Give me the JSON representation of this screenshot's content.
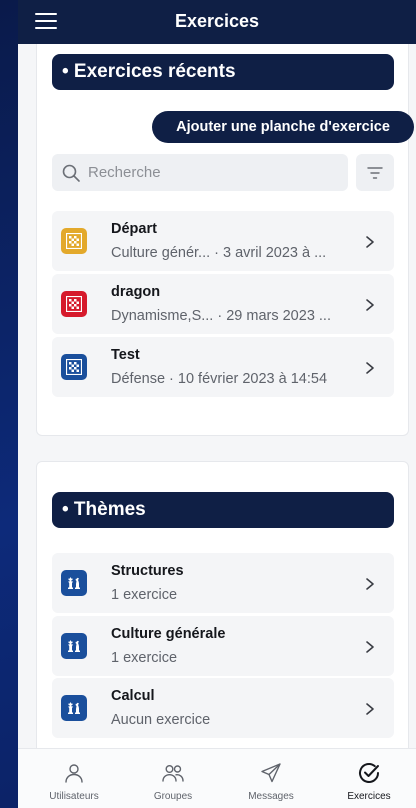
{
  "header": {
    "title": "Exercices"
  },
  "recent": {
    "title": "• Exercices récents",
    "add_button": "Ajouter une planche d'exercice",
    "search_placeholder": "Recherche",
    "items": [
      {
        "title": "Départ",
        "subtitle": "Culture génér... · 3 avril 2023 à ...",
        "color": "#e3a92b"
      },
      {
        "title": "dragon",
        "subtitle": "Dynamisme,S... · 29 mars 2023 ...",
        "color": "#d61a2c"
      },
      {
        "title": "Test",
        "subtitle": "Défense · 10 février 2023 à 14:54",
        "color": "#1a4f9c"
      }
    ]
  },
  "themes": {
    "title": "• Thèmes",
    "items": [
      {
        "title": "Structures",
        "subtitle": "1 exercice"
      },
      {
        "title": "Culture générale",
        "subtitle": "1 exercice"
      },
      {
        "title": "Calcul",
        "subtitle": "Aucun exercice"
      }
    ],
    "icon_color": "#1a4f9c"
  },
  "nav": {
    "items": [
      {
        "label": "Utilisateurs",
        "icon": "user-icon"
      },
      {
        "label": "Groupes",
        "icon": "group-icon"
      },
      {
        "label": "Messages",
        "icon": "send-icon"
      },
      {
        "label": "Exercices",
        "icon": "check-circle-icon"
      }
    ],
    "active": "Exercices"
  }
}
